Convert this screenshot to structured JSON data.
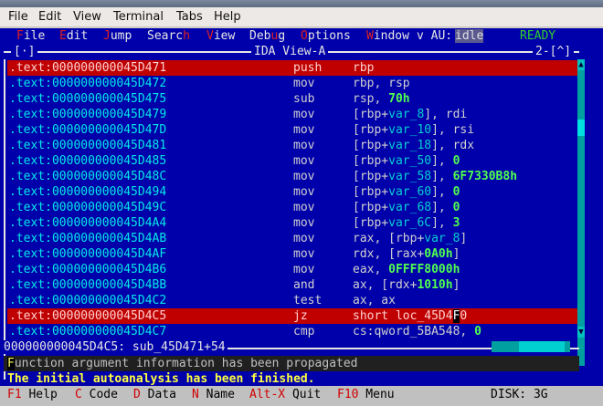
{
  "terminal_menu": [
    "File",
    "Edit",
    "View",
    "Terminal",
    "Tabs",
    "Help"
  ],
  "ida_menu": {
    "file": {
      "hot": "F",
      "rest": "ile"
    },
    "edit": {
      "hot": "E",
      "rest": "dit"
    },
    "jump": {
      "hot": "J",
      "rest": "ump"
    },
    "search": {
      "pre": "Searc",
      "hot": "h"
    },
    "view": {
      "hot": "V",
      "rest": "iew"
    },
    "debug": {
      "pre": "Deb",
      "hot": "u",
      "rest": "g"
    },
    "options": {
      "hot": "O",
      "rest": "ptions"
    },
    "window": {
      "hot": "W",
      "rest": "indow"
    },
    "extra": "v AU:",
    "au_state": "idle",
    "ready": "READY"
  },
  "view": {
    "left_marker": "[·]",
    "title": "IDA View-A",
    "right_marker": "2-[^]"
  },
  "rows": [
    {
      "addr": ".text:000000000045D471",
      "mnemonic": "push",
      "ops": [
        {
          "t": "rbp",
          "k": "p"
        }
      ],
      "selected": true
    },
    {
      "addr": ".text:000000000045D472",
      "mnemonic": "mov",
      "ops": [
        {
          "t": "rbp, rsp",
          "k": "p"
        }
      ]
    },
    {
      "addr": ".text:000000000045D475",
      "mnemonic": "sub",
      "ops": [
        {
          "t": "rsp, ",
          "k": "p"
        },
        {
          "t": "70h",
          "k": "n"
        }
      ]
    },
    {
      "addr": ".text:000000000045D479",
      "mnemonic": "mov",
      "ops": [
        {
          "t": "[rbp+",
          "k": "p"
        },
        {
          "t": "var_8",
          "k": "v"
        },
        {
          "t": "], rdi",
          "k": "p"
        }
      ]
    },
    {
      "addr": ".text:000000000045D47D",
      "mnemonic": "mov",
      "ops": [
        {
          "t": "[rbp+",
          "k": "p"
        },
        {
          "t": "var_10",
          "k": "v"
        },
        {
          "t": "], rsi",
          "k": "p"
        }
      ]
    },
    {
      "addr": ".text:000000000045D481",
      "mnemonic": "mov",
      "ops": [
        {
          "t": "[rbp+",
          "k": "p"
        },
        {
          "t": "var_18",
          "k": "v"
        },
        {
          "t": "], rdx",
          "k": "p"
        }
      ]
    },
    {
      "addr": ".text:000000000045D485",
      "mnemonic": "mov",
      "ops": [
        {
          "t": "[rbp+",
          "k": "p"
        },
        {
          "t": "var_50",
          "k": "v"
        },
        {
          "t": "], ",
          "k": "p"
        },
        {
          "t": "0",
          "k": "n"
        }
      ]
    },
    {
      "addr": ".text:000000000045D48C",
      "mnemonic": "mov",
      "ops": [
        {
          "t": "[rbp+",
          "k": "p"
        },
        {
          "t": "var_58",
          "k": "v"
        },
        {
          "t": "], ",
          "k": "p"
        },
        {
          "t": "6F7330B8h",
          "k": "n"
        }
      ]
    },
    {
      "addr": ".text:000000000045D494",
      "mnemonic": "mov",
      "ops": [
        {
          "t": "[rbp+",
          "k": "p"
        },
        {
          "t": "var_60",
          "k": "v"
        },
        {
          "t": "], ",
          "k": "p"
        },
        {
          "t": "0",
          "k": "n"
        }
      ]
    },
    {
      "addr": ".text:000000000045D49C",
      "mnemonic": "mov",
      "ops": [
        {
          "t": "[rbp+",
          "k": "p"
        },
        {
          "t": "var_68",
          "k": "v"
        },
        {
          "t": "], ",
          "k": "p"
        },
        {
          "t": "0",
          "k": "n"
        }
      ]
    },
    {
      "addr": ".text:000000000045D4A4",
      "mnemonic": "mov",
      "ops": [
        {
          "t": "[rbp+",
          "k": "p"
        },
        {
          "t": "var_6C",
          "k": "v"
        },
        {
          "t": "], ",
          "k": "p"
        },
        {
          "t": "3",
          "k": "n"
        }
      ]
    },
    {
      "addr": ".text:000000000045D4AB",
      "mnemonic": "mov",
      "ops": [
        {
          "t": "rax, [rbp+",
          "k": "p"
        },
        {
          "t": "var_8",
          "k": "v"
        },
        {
          "t": "]",
          "k": "p"
        }
      ]
    },
    {
      "addr": ".text:000000000045D4AF",
      "mnemonic": "mov",
      "ops": [
        {
          "t": "rdx, [rax+",
          "k": "p"
        },
        {
          "t": "0A0h",
          "k": "n"
        },
        {
          "t": "]",
          "k": "p"
        }
      ]
    },
    {
      "addr": ".text:000000000045D4B6",
      "mnemonic": "mov",
      "ops": [
        {
          "t": "eax, ",
          "k": "p"
        },
        {
          "t": "0FFFF8000h",
          "k": "n"
        }
      ]
    },
    {
      "addr": ".text:000000000045D4BB",
      "mnemonic": "and",
      "ops": [
        {
          "t": "ax, [rdx+",
          "k": "p"
        },
        {
          "t": "1010h",
          "k": "n"
        },
        {
          "t": "]",
          "k": "p"
        }
      ]
    },
    {
      "addr": ".text:000000000045D4C2",
      "mnemonic": "test",
      "ops": [
        {
          "t": "ax, ax",
          "k": "p"
        }
      ]
    },
    {
      "addr": ".text:000000000045D4C5",
      "mnemonic": "jz",
      "ops": [
        {
          "t": "short loc_45D4",
          "k": "p"
        },
        {
          "t": "F",
          "k": "c"
        },
        {
          "t": "0",
          "k": "p"
        }
      ],
      "selected": true
    },
    {
      "addr": ".text:000000000045D4C7",
      "mnemonic": "cmp",
      "ops": [
        {
          "t": "cs:qword_5BA548, ",
          "k": "p"
        },
        {
          "t": "0",
          "k": "n"
        }
      ]
    }
  ],
  "location": "000000000045D4C5: sub_45D471+54",
  "output": {
    "line1_first": "F",
    "line1_rest": "unction argument information has been propagated",
    "line2": "The initial autoanalysis has been finished."
  },
  "fkeys": [
    {
      "key": "F1",
      "label": " Help"
    },
    {
      "key": "C",
      "label": " Code"
    },
    {
      "key": "D",
      "label": " Data"
    },
    {
      "key": "N",
      "label": " Name"
    },
    {
      "key": "Alt-X",
      "label": " Quit"
    },
    {
      "key": "F10",
      "label": " Menu"
    }
  ],
  "disk": "DISK: 3G"
}
